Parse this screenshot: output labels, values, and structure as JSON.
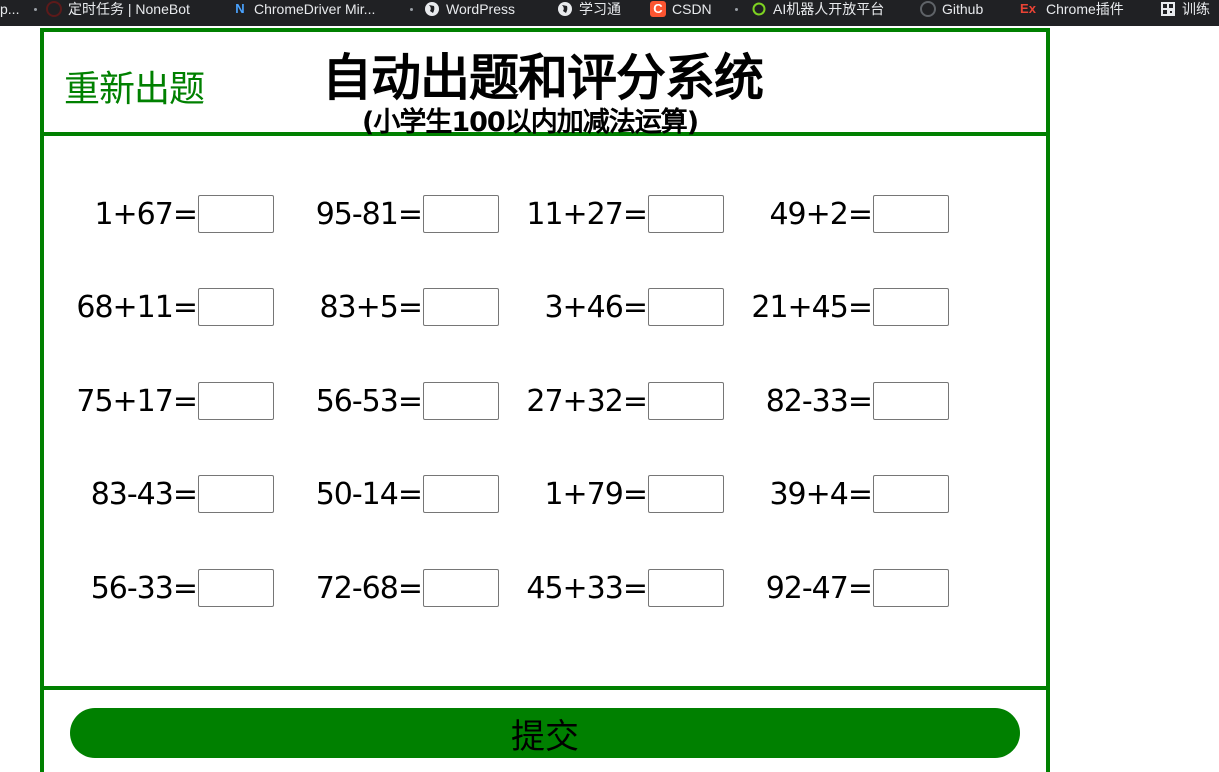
{
  "bookmarks": [
    {
      "label": "p...",
      "icon": "",
      "color": "#e8eaed"
    },
    {
      "label": "定时任务 | NoneBot",
      "icon": "nonebot-icon",
      "color": "#ea4335"
    },
    {
      "label": "ChromeDriver Mir...",
      "icon": "n-icon",
      "color": "#4285f4"
    },
    {
      "label": "WordPress",
      "icon": "globe-icon",
      "color": "#e8eaed"
    },
    {
      "label": "学习通",
      "icon": "globe-icon",
      "color": "#e8eaed"
    },
    {
      "label": "CSDN",
      "icon": "csdn-icon",
      "color": "#fc5531"
    },
    {
      "label": "AI机器人开放平台",
      "icon": "ring-icon",
      "color": "#7ed321"
    },
    {
      "label": "Github",
      "icon": "github-icon",
      "color": "#5f6368"
    },
    {
      "label": "Chrome插件",
      "icon": "ex-icon",
      "color": "#ea4335"
    },
    {
      "label": "训练",
      "icon": "qr-icon",
      "color": "#e8eaed"
    }
  ],
  "header": {
    "regen_label": "重新出题",
    "title": "自动出题和评分系统",
    "subtitle": "(小学生100以内加减法运算)"
  },
  "problems": [
    [
      "1+67=",
      "95-81=",
      "11+27=",
      "49+2="
    ],
    [
      "68+11=",
      "83+5=",
      "3+46=",
      "21+45="
    ],
    [
      "75+17=",
      "56-53=",
      "27+32=",
      "82-33="
    ],
    [
      "83-43=",
      "50-14=",
      "1+79=",
      "39+4="
    ],
    [
      "56-33=",
      "72-68=",
      "45+33=",
      "92-47="
    ]
  ],
  "submit_label": "提交",
  "colors": {
    "accent": "#008000"
  }
}
